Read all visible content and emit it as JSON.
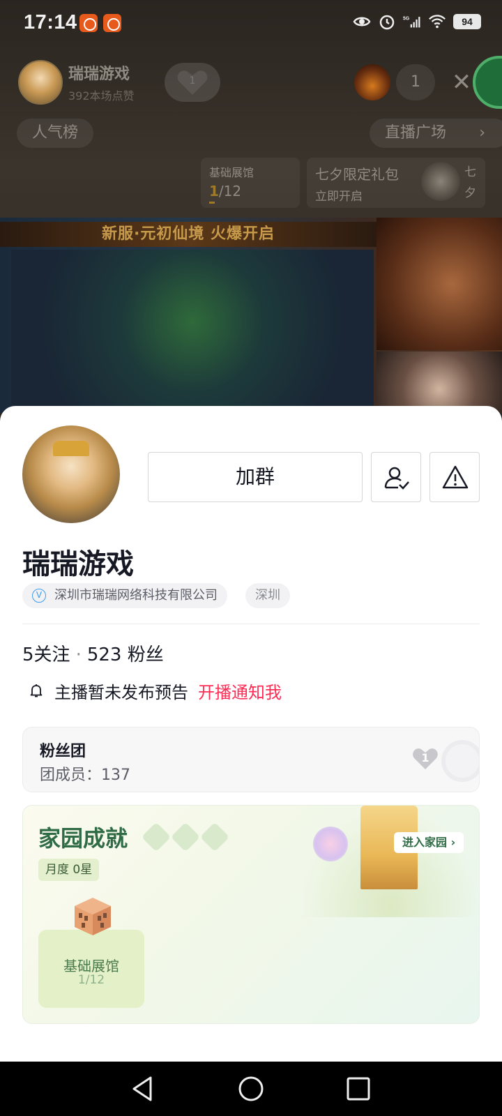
{
  "status_bar": {
    "time": "17:14",
    "battery": "94",
    "icons": [
      "eye-icon",
      "alarm-icon",
      "5g-signal-icon",
      "wifi-icon",
      "battery-icon"
    ]
  },
  "live_header": {
    "streamer_name": "瑞瑞游戏",
    "likes": "392本场点赞",
    "fan_level": "1",
    "viewer_count": "1",
    "rank_label": "人气榜",
    "plaza_label": "直播广场",
    "exhibit": {
      "title": "基础展馆",
      "progress_current": "1",
      "progress_rest": "/12"
    },
    "gift": {
      "title": "七夕限定礼包",
      "subtitle": "立即开启",
      "side_text": "七夕"
    }
  },
  "video": {
    "banner": "新服·元初仙境 火爆开启"
  },
  "profile": {
    "name": "瑞瑞游戏",
    "join_group_label": "加群",
    "company": "深圳市瑞瑞网络科技有限公司",
    "verified_mark": "V",
    "city": "深圳",
    "following_count": "5",
    "following_label": "关注",
    "followers_count": "523",
    "followers_label": "粉丝",
    "separator": "·",
    "notice_text": "主播暂未发布预告",
    "notice_link": "开播通知我"
  },
  "fans_club": {
    "title": "粉丝团",
    "members": "团成员：137",
    "level": "1"
  },
  "home": {
    "title": "家园成就",
    "enter_label": "进入家园",
    "month_badge": "月度  0星",
    "exhibit_name": "基础展馆",
    "exhibit_progress": "1/12"
  },
  "colors": {
    "accent_red": "#fe2c55",
    "home_green": "#2f6b45",
    "verified_blue": "#3d9cf0"
  }
}
